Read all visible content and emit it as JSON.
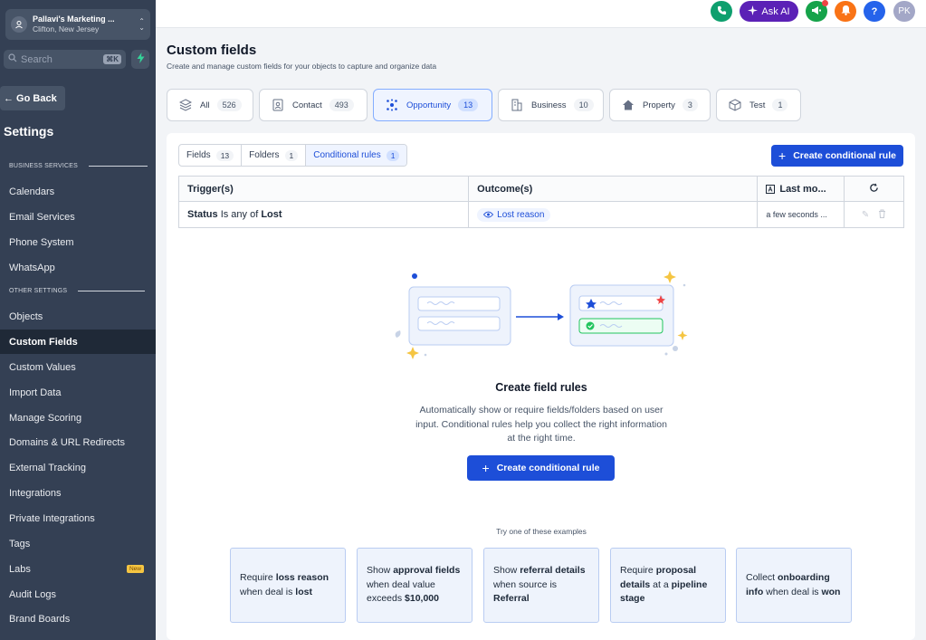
{
  "account": {
    "name": "Pallavi's Marketing ...",
    "location": "Clifton, New Jersey"
  },
  "search": {
    "placeholder": "Search",
    "shortcut": "⌘K"
  },
  "sidebar": {
    "go_back": "← Go Back",
    "title": "Settings",
    "section_business": "BUSINESS SERVICES",
    "section_other": "OTHER SETTINGS",
    "items_business": [
      "Calendars",
      "Email Services",
      "Phone System",
      "WhatsApp"
    ],
    "items_other": [
      "Objects",
      "Custom Fields",
      "Custom Values",
      "Import Data",
      "Manage Scoring",
      "Domains & URL Redirects",
      "External Tracking",
      "Integrations",
      "Private Integrations",
      "Tags",
      "Labs",
      "Audit Logs",
      "Brand Boards"
    ],
    "labs_badge": "New",
    "active_item": "Custom Fields"
  },
  "topbar": {
    "ask_ai": "Ask AI",
    "help": "?",
    "user_initials": "PK"
  },
  "header": {
    "title": "Custom fields",
    "subtitle": "Create and manage custom fields for your objects to capture and organize data"
  },
  "object_tabs": [
    {
      "label": "All",
      "count": "526"
    },
    {
      "label": "Contact",
      "count": "493"
    },
    {
      "label": "Opportunity",
      "count": "13"
    },
    {
      "label": "Business",
      "count": "10"
    },
    {
      "label": "Property",
      "count": "3"
    },
    {
      "label": "Test",
      "count": "1"
    }
  ],
  "sub_tabs": [
    {
      "label": "Fields",
      "count": "13"
    },
    {
      "label": "Folders",
      "count": "1"
    },
    {
      "label": "Conditional rules",
      "count": "1"
    }
  ],
  "create_rule_label": "Create conditional rule",
  "table": {
    "headers": [
      "Trigger(s)",
      "Outcome(s)",
      "Last mo..."
    ],
    "rows": [
      {
        "trigger_field": "Status",
        "trigger_op": "Is any of",
        "trigger_value": "Lost",
        "outcome": "Lost reason",
        "modified": "a few seconds ..."
      }
    ]
  },
  "empty_state": {
    "title": "Create field rules",
    "description": "Automatically show or require fields/folders based on user input. Conditional rules help you collect the right information at the right time.",
    "button": "Create conditional rule",
    "examples_label": "Try one of these examples"
  },
  "examples": [
    [
      {
        "t": "Require ",
        "b": false
      },
      {
        "t": "loss reason",
        "b": true
      },
      {
        "t": " when deal is ",
        "b": false
      },
      {
        "t": "lost",
        "b": true
      }
    ],
    [
      {
        "t": "Show ",
        "b": false
      },
      {
        "t": "approval fields",
        "b": true
      },
      {
        "t": " when deal value exceeds ",
        "b": false
      },
      {
        "t": "$10,000",
        "b": true
      }
    ],
    [
      {
        "t": "Show ",
        "b": false
      },
      {
        "t": "referral details",
        "b": true
      },
      {
        "t": " when source is ",
        "b": false
      },
      {
        "t": "Referral",
        "b": true
      }
    ],
    [
      {
        "t": "Require ",
        "b": false
      },
      {
        "t": "proposal details",
        "b": true
      },
      {
        "t": " at a ",
        "b": false
      },
      {
        "t": "pipeline stage",
        "b": true
      }
    ],
    [
      {
        "t": "Collect ",
        "b": false
      },
      {
        "t": "onboarding info",
        "b": true
      },
      {
        "t": " when deal is ",
        "b": false
      },
      {
        "t": "won",
        "b": true
      }
    ]
  ],
  "colors": {
    "primary": "#1d4ed8",
    "sidebar": "#344054",
    "active_nav": "#1f2937",
    "phone": "#0e9f6e",
    "ask_ai": "#5b21b6",
    "announce": "#16a34a",
    "bell": "#f97316",
    "help": "#2563eb"
  }
}
